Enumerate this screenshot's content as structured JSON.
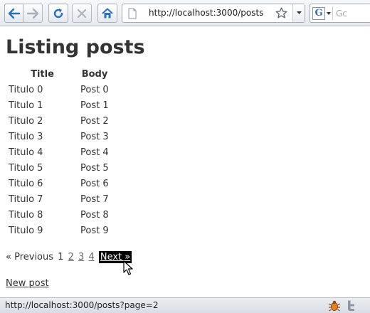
{
  "browser": {
    "url": "http://localhost:3000/posts",
    "search_placeholder": "Gc",
    "search_engine_letter": "G",
    "status_text": "http://localhost:3000/posts?page=2",
    "icons": {
      "back": "arrow-left-icon",
      "forward": "arrow-right-icon",
      "reload": "reload-icon",
      "stop": "stop-icon",
      "home": "home-icon",
      "page": "page-icon",
      "bookmark": "star-icon",
      "url_dropdown": "chevron-down-icon",
      "firebug": "firebug-icon",
      "twitter": "twitter-icon"
    }
  },
  "page": {
    "title": "Listing posts",
    "table": {
      "headers": [
        "Title",
        "Body"
      ],
      "rows": [
        [
          "Titulo 0",
          "Post 0"
        ],
        [
          "Titulo 1",
          "Post 1"
        ],
        [
          "Titulo 2",
          "Post 2"
        ],
        [
          "Titulo 3",
          "Post 3"
        ],
        [
          "Titulo 4",
          "Post 4"
        ],
        [
          "Titulo 5",
          "Post 5"
        ],
        [
          "Titulo 6",
          "Post 6"
        ],
        [
          "Titulo 7",
          "Post 7"
        ],
        [
          "Titulo 8",
          "Post 8"
        ],
        [
          "Titulo 9",
          "Post 9"
        ]
      ]
    },
    "pagination": {
      "previous": "« Previous",
      "current": "1",
      "pages": [
        "2",
        "3",
        "4"
      ],
      "next": "Next »"
    },
    "new_post_link": "New post"
  },
  "colors": {
    "text": "#333333",
    "next_highlight_bg": "#000000",
    "next_highlight_fg": "#ffffff"
  }
}
